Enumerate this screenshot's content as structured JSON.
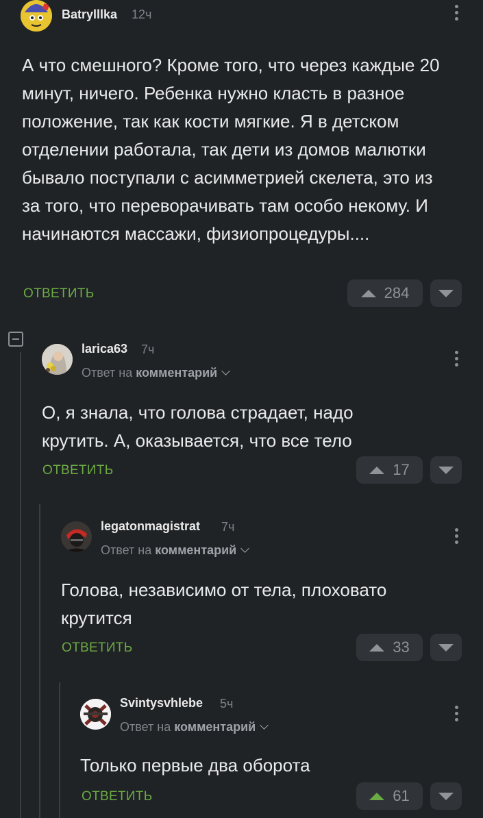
{
  "comments": [
    {
      "username": "Batrylllka",
      "time": "12ч",
      "text": "А что смешного? Кроме того, что через каждые 20 минут, ничего. Ребенка нужно класть в разное положение, так как кости мягкие. Я в детском отделении работала, так дети из домов малютки бывало поступали с асимметрией скелета, это из за того, что переворачивать там особо некому. И начинаются массажи, физиопроцедуры....",
      "reply_label": "ОТВЕТИТЬ",
      "rating": "284"
    },
    {
      "username": "larica63",
      "time": "7ч",
      "reply_to_prefix": "Ответ на",
      "reply_to_link": "комментарий",
      "text": "О, я знала, что голова страдает, надо крутить. А, оказывается, что все тело",
      "reply_label": "ОТВЕТИТЬ",
      "rating": "17"
    },
    {
      "username": "legatonmagistrat",
      "time": "7ч",
      "reply_to_prefix": "Ответ на",
      "reply_to_link": "комментарий",
      "text": "Голова, независимо от тела, плоховато крутится",
      "reply_label": "ОТВЕТИТЬ",
      "rating": "33"
    },
    {
      "username": "Svintysvhlebe",
      "time": "5ч",
      "reply_to_prefix": "Ответ на",
      "reply_to_link": "комментарий",
      "text": "Только первые два оборота",
      "reply_label": "ОТВЕТИТЬ",
      "rating": "61"
    }
  ],
  "colors": {
    "background": "#202326",
    "accent_green": "#6bab43",
    "button_bg": "#303438",
    "muted": "#7f8489"
  }
}
